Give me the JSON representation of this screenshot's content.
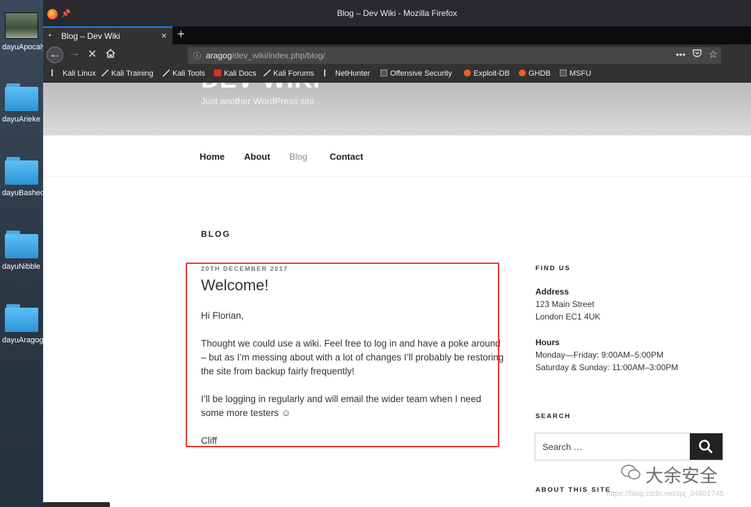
{
  "desktop": {
    "icons": [
      {
        "label": "dayuApocaly"
      },
      {
        "label": "dayuArieke"
      },
      {
        "label": "dayuBashed"
      },
      {
        "label": "dayuNibble"
      },
      {
        "label": "dayuAragog"
      }
    ]
  },
  "browser": {
    "window_title": "Blog – Dev Wiki - Mozilla Firefox",
    "tab_title": "Blog – Dev Wiki",
    "url_host": "aragog",
    "url_path": "/dev_wiki/index.php/blog/",
    "bookmarks": [
      "Kali Linux",
      "Kali Training",
      "Kali Tools",
      "Kali Docs",
      "Kali Forums",
      "NetHunter",
      "Offensive Security",
      "Exploit-DB",
      "GHDB",
      "MSFU"
    ]
  },
  "site": {
    "title": "DEV WIKI",
    "tagline": "Just another WordPress site",
    "menu": [
      "Home",
      "About",
      "Blog",
      "Contact"
    ],
    "current_menu": "Blog"
  },
  "main": {
    "heading": "BLOG",
    "post": {
      "date": "20TH DECEMBER 2017",
      "title": "Welcome!",
      "paragraphs": [
        "Hi Florian,",
        "Thought we could use a wiki.  Feel free to log in and have a poke around – but as I’m messing about with a lot of changes I’ll probably be restoring the site from backup fairly frequently!",
        "I’ll be logging in regularly and will email the wider team when I need some more testers ☺",
        "Cliff"
      ]
    }
  },
  "sidebar": {
    "find_us": {
      "title": "FIND US",
      "address_label": "Address",
      "address_line1": "123 Main Street",
      "address_line2": "London EC1 4UK",
      "hours_label": "Hours",
      "hours_line1": "Monday—Friday: 9:00AM–5:00PM",
      "hours_line2": "Saturday & Sunday: 11:00AM–3:00PM"
    },
    "search": {
      "title": "SEARCH",
      "placeholder": "Search …"
    },
    "about": {
      "title": "ABOUT THIS SITE"
    }
  },
  "overlay": {
    "watermark": "大余安全",
    "csdn": "https://blog.csdn.net/qq_34801745"
  },
  "colors": {
    "highlight": "#ee3333",
    "accent": "#0a84ff"
  }
}
